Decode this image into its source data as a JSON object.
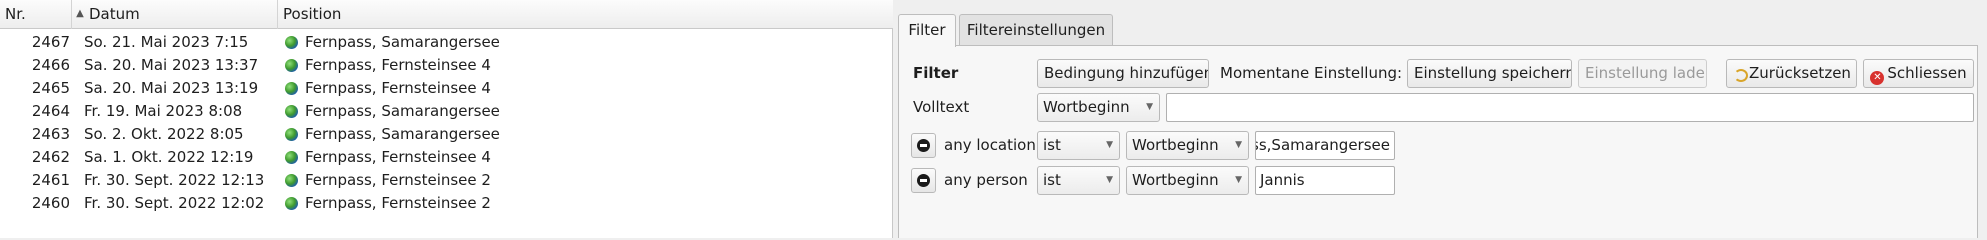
{
  "table": {
    "columns": {
      "nr": "Nr.",
      "datum": "Datum",
      "position": "Position"
    },
    "sort_indicator": "▲",
    "rows": [
      {
        "nr": "2467",
        "datum": "So. 21. Mai 2023 7:15",
        "position": "Fernpass, Samarangersee"
      },
      {
        "nr": "2466",
        "datum": "Sa. 20. Mai 2023 13:37",
        "position": "Fernpass, Fernsteinsee 4"
      },
      {
        "nr": "2465",
        "datum": "Sa. 20. Mai 2023 13:19",
        "position": "Fernpass, Fernsteinsee 4"
      },
      {
        "nr": "2464",
        "datum": "Fr. 19. Mai 2023 8:08",
        "position": "Fernpass, Samarangersee"
      },
      {
        "nr": "2463",
        "datum": "So. 2. Okt. 2022 8:05",
        "position": "Fernpass, Samarangersee"
      },
      {
        "nr": "2462",
        "datum": "Sa. 1. Okt. 2022 12:19",
        "position": "Fernpass, Fernsteinsee 4"
      },
      {
        "nr": "2461",
        "datum": "Fr. 30. Sept. 2022 12:13",
        "position": "Fernpass, Fernsteinsee 2"
      },
      {
        "nr": "2460",
        "datum": "Fr. 30. Sept. 2022 12:02",
        "position": "Fernpass, Fernsteinsee 2"
      }
    ]
  },
  "tabs": [
    {
      "label": "Filter",
      "active": true
    },
    {
      "label": "Filtereinstellungen",
      "active": false
    }
  ],
  "filter": {
    "title": "Filter",
    "add_condition_label": "Bedingung hinzufügen…",
    "current_setting_label": "Momentane Einstellung:",
    "save_setting_label": "Einstellung speichern",
    "load_setting_label": "Einstellung laden",
    "reset_label": "Zurücksetzen",
    "close_label": "Schliessen",
    "fulltext": {
      "label": "Volltext",
      "mode": "Wortbeginn",
      "value": ""
    },
    "conditions": [
      {
        "field": "any location",
        "operator": "ist",
        "mode": "Wortbeginn",
        "value": "Fernpass,Samarangersee"
      },
      {
        "field": "any person",
        "operator": "ist",
        "mode": "Wortbeginn",
        "value": "Jannis"
      }
    ]
  },
  "colors": {
    "panel_bg": "#efefef",
    "close_icon": "#d8322e",
    "reset_icon": "#d9a52a"
  },
  "icons": {
    "row_icon": "globe-icon",
    "remove_icon": "remove-icon",
    "reset_icon": "undo-icon",
    "close_icon": "close-icon"
  }
}
